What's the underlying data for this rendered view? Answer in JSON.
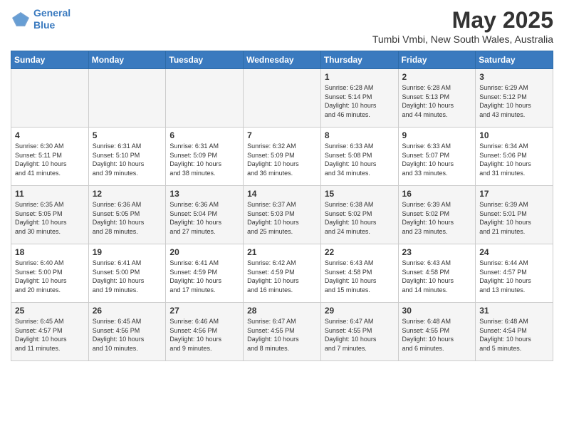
{
  "header": {
    "logo_line1": "General",
    "logo_line2": "Blue",
    "month": "May 2025",
    "location": "Tumbi Vmbi, New South Wales, Australia"
  },
  "weekdays": [
    "Sunday",
    "Monday",
    "Tuesday",
    "Wednesday",
    "Thursday",
    "Friday",
    "Saturday"
  ],
  "weeks": [
    [
      {
        "day": "",
        "content": ""
      },
      {
        "day": "",
        "content": ""
      },
      {
        "day": "",
        "content": ""
      },
      {
        "day": "",
        "content": ""
      },
      {
        "day": "1",
        "content": "Sunrise: 6:28 AM\nSunset: 5:14 PM\nDaylight: 10 hours\nand 46 minutes."
      },
      {
        "day": "2",
        "content": "Sunrise: 6:28 AM\nSunset: 5:13 PM\nDaylight: 10 hours\nand 44 minutes."
      },
      {
        "day": "3",
        "content": "Sunrise: 6:29 AM\nSunset: 5:12 PM\nDaylight: 10 hours\nand 43 minutes."
      }
    ],
    [
      {
        "day": "4",
        "content": "Sunrise: 6:30 AM\nSunset: 5:11 PM\nDaylight: 10 hours\nand 41 minutes."
      },
      {
        "day": "5",
        "content": "Sunrise: 6:31 AM\nSunset: 5:10 PM\nDaylight: 10 hours\nand 39 minutes."
      },
      {
        "day": "6",
        "content": "Sunrise: 6:31 AM\nSunset: 5:09 PM\nDaylight: 10 hours\nand 38 minutes."
      },
      {
        "day": "7",
        "content": "Sunrise: 6:32 AM\nSunset: 5:09 PM\nDaylight: 10 hours\nand 36 minutes."
      },
      {
        "day": "8",
        "content": "Sunrise: 6:33 AM\nSunset: 5:08 PM\nDaylight: 10 hours\nand 34 minutes."
      },
      {
        "day": "9",
        "content": "Sunrise: 6:33 AM\nSunset: 5:07 PM\nDaylight: 10 hours\nand 33 minutes."
      },
      {
        "day": "10",
        "content": "Sunrise: 6:34 AM\nSunset: 5:06 PM\nDaylight: 10 hours\nand 31 minutes."
      }
    ],
    [
      {
        "day": "11",
        "content": "Sunrise: 6:35 AM\nSunset: 5:05 PM\nDaylight: 10 hours\nand 30 minutes."
      },
      {
        "day": "12",
        "content": "Sunrise: 6:36 AM\nSunset: 5:05 PM\nDaylight: 10 hours\nand 28 minutes."
      },
      {
        "day": "13",
        "content": "Sunrise: 6:36 AM\nSunset: 5:04 PM\nDaylight: 10 hours\nand 27 minutes."
      },
      {
        "day": "14",
        "content": "Sunrise: 6:37 AM\nSunset: 5:03 PM\nDaylight: 10 hours\nand 25 minutes."
      },
      {
        "day": "15",
        "content": "Sunrise: 6:38 AM\nSunset: 5:02 PM\nDaylight: 10 hours\nand 24 minutes."
      },
      {
        "day": "16",
        "content": "Sunrise: 6:39 AM\nSunset: 5:02 PM\nDaylight: 10 hours\nand 23 minutes."
      },
      {
        "day": "17",
        "content": "Sunrise: 6:39 AM\nSunset: 5:01 PM\nDaylight: 10 hours\nand 21 minutes."
      }
    ],
    [
      {
        "day": "18",
        "content": "Sunrise: 6:40 AM\nSunset: 5:00 PM\nDaylight: 10 hours\nand 20 minutes."
      },
      {
        "day": "19",
        "content": "Sunrise: 6:41 AM\nSunset: 5:00 PM\nDaylight: 10 hours\nand 19 minutes."
      },
      {
        "day": "20",
        "content": "Sunrise: 6:41 AM\nSunset: 4:59 PM\nDaylight: 10 hours\nand 17 minutes."
      },
      {
        "day": "21",
        "content": "Sunrise: 6:42 AM\nSunset: 4:59 PM\nDaylight: 10 hours\nand 16 minutes."
      },
      {
        "day": "22",
        "content": "Sunrise: 6:43 AM\nSunset: 4:58 PM\nDaylight: 10 hours\nand 15 minutes."
      },
      {
        "day": "23",
        "content": "Sunrise: 6:43 AM\nSunset: 4:58 PM\nDaylight: 10 hours\nand 14 minutes."
      },
      {
        "day": "24",
        "content": "Sunrise: 6:44 AM\nSunset: 4:57 PM\nDaylight: 10 hours\nand 13 minutes."
      }
    ],
    [
      {
        "day": "25",
        "content": "Sunrise: 6:45 AM\nSunset: 4:57 PM\nDaylight: 10 hours\nand 11 minutes."
      },
      {
        "day": "26",
        "content": "Sunrise: 6:45 AM\nSunset: 4:56 PM\nDaylight: 10 hours\nand 10 minutes."
      },
      {
        "day": "27",
        "content": "Sunrise: 6:46 AM\nSunset: 4:56 PM\nDaylight: 10 hours\nand 9 minutes."
      },
      {
        "day": "28",
        "content": "Sunrise: 6:47 AM\nSunset: 4:55 PM\nDaylight: 10 hours\nand 8 minutes."
      },
      {
        "day": "29",
        "content": "Sunrise: 6:47 AM\nSunset: 4:55 PM\nDaylight: 10 hours\nand 7 minutes."
      },
      {
        "day": "30",
        "content": "Sunrise: 6:48 AM\nSunset: 4:55 PM\nDaylight: 10 hours\nand 6 minutes."
      },
      {
        "day": "31",
        "content": "Sunrise: 6:48 AM\nSunset: 4:54 PM\nDaylight: 10 hours\nand 5 minutes."
      }
    ]
  ]
}
